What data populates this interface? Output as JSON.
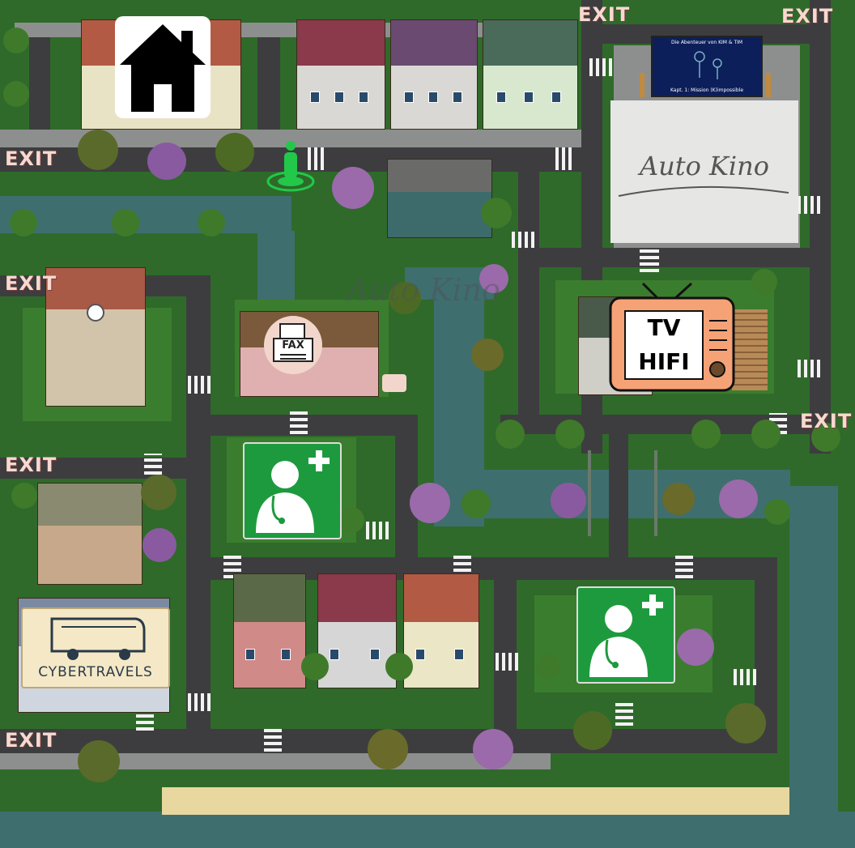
{
  "game": {
    "exits": [
      "EXIT",
      "EXIT",
      "EXIT",
      "EXIT",
      "EXIT",
      "EXIT",
      "EXIT"
    ],
    "cinema": {
      "sign_text": "Auto Kino",
      "screen_title": "Die Abenteuer von KIM & TIM",
      "screen_subtitle": "Kapt. 1: Mission (K)impossible",
      "ghost_text": "Auto Kino"
    },
    "tv_shop": {
      "line1": "TV",
      "line2": "HIFI"
    },
    "fax_shop": {
      "label": "FAX"
    },
    "travel_agency": {
      "label": "CYBERTRAVELS"
    },
    "home": {
      "icon": "home-icon"
    },
    "doctors": [
      {
        "icon": "doctor-icon"
      },
      {
        "icon": "doctor-icon"
      }
    ],
    "player": {
      "icon": "player-marker-icon"
    },
    "colors": {
      "grass": "#2f6a2a",
      "water": "#3f6e6e",
      "road": "#3d3d3f",
      "sidewalk": "#8d8f8e",
      "doctor_green": "#1e9a3e",
      "tv_orange": "#f6a277",
      "exit_text": "#f7d9d0",
      "player_green": "#22c84a"
    }
  }
}
